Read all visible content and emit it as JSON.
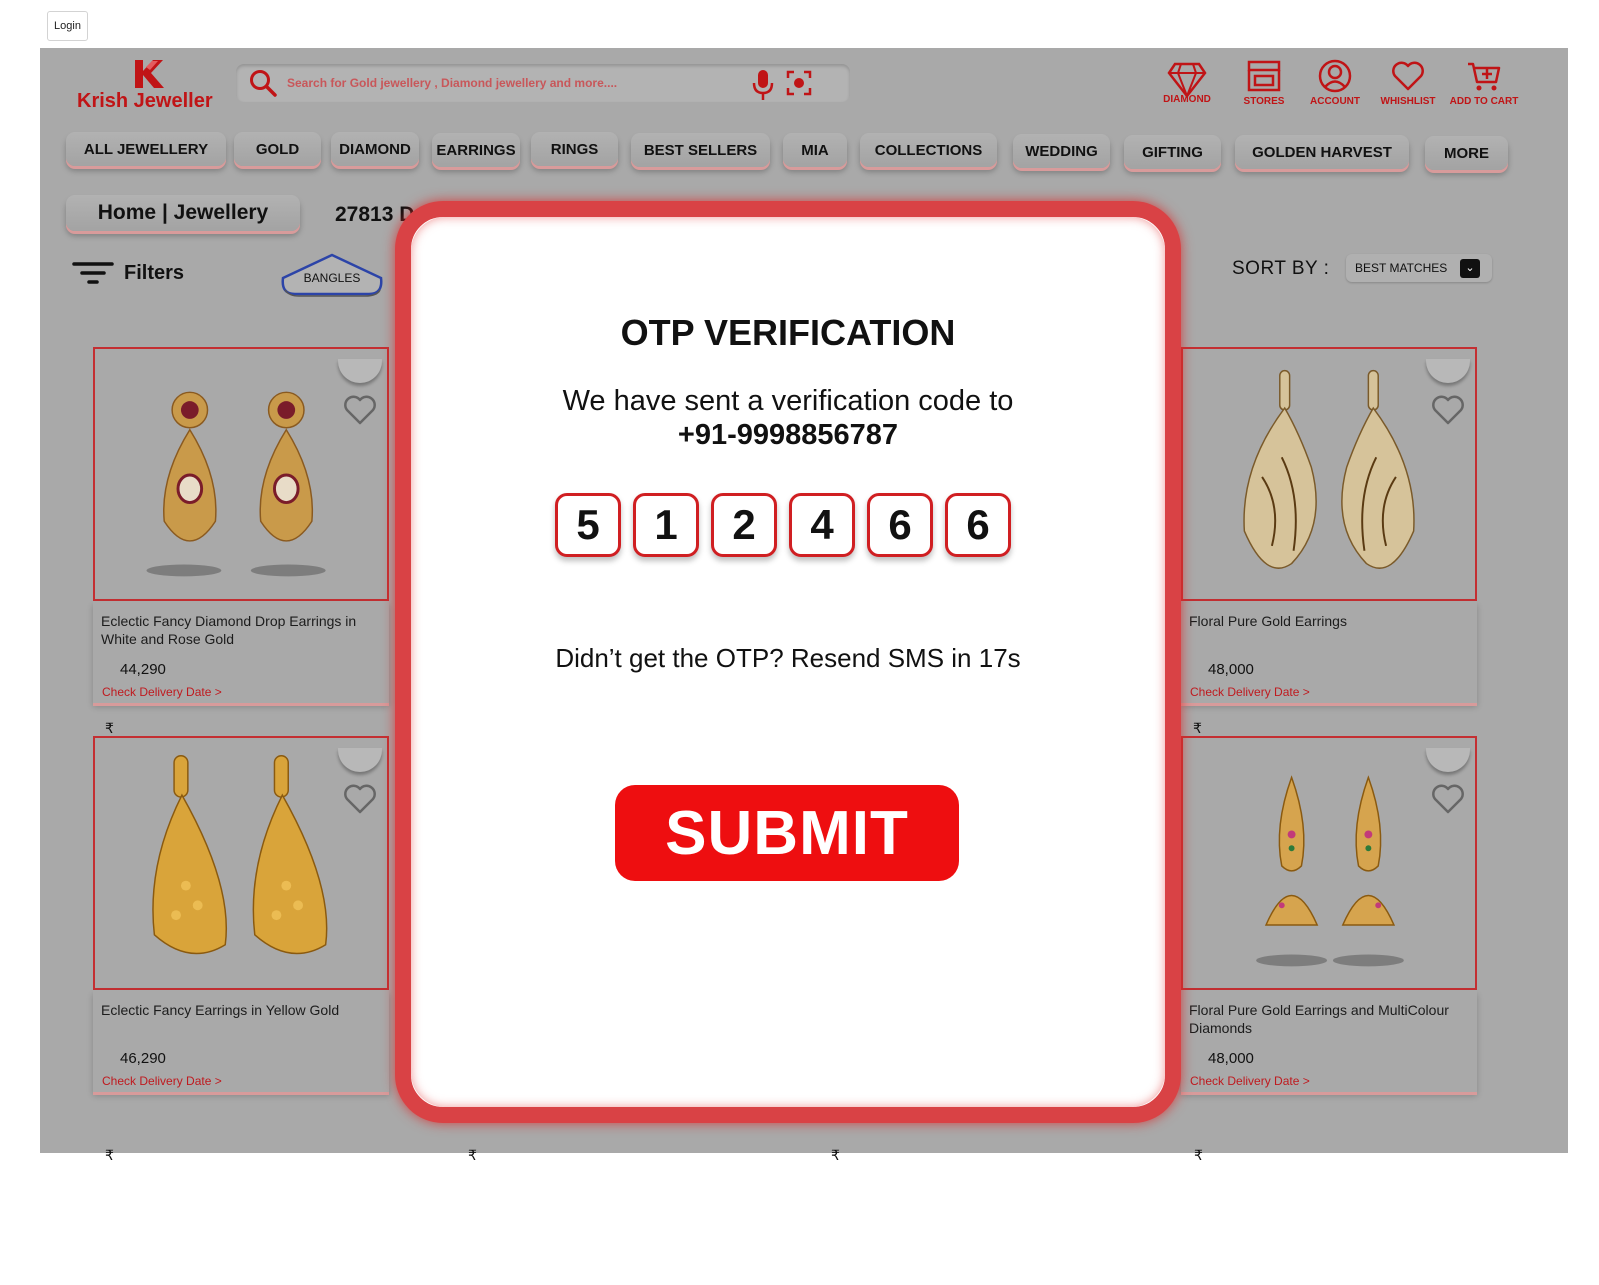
{
  "page": {
    "login_label": "Login"
  },
  "header": {
    "brand": "Krish Jeweller",
    "search_placeholder": "Search  for Gold jewellery , Diamond  jewellery and more....",
    "icons": [
      {
        "label": "DIAMOND",
        "icon": "diamond-icon"
      },
      {
        "label": "STORES",
        "icon": "store-icon"
      },
      {
        "label": "ACCOUNT",
        "icon": "account-icon"
      },
      {
        "label": "WHISHLIST",
        "icon": "heart-icon"
      },
      {
        "label": "ADD TO CART",
        "icon": "cart-icon"
      }
    ],
    "accent": "#c01416"
  },
  "nav": [
    "ALL JEWELLERY",
    "GOLD",
    "DIAMOND",
    "EARRINGS",
    "RINGS",
    "BEST SELLERS",
    "MIA",
    "COLLECTIONS",
    "WEDDING",
    "GIFTING",
    "GOLDEN HARVEST",
    "MORE"
  ],
  "breadcrumb": "Home | Jewellery",
  "result_count": "27813 D",
  "filters": {
    "label": "Filters",
    "chip": "BANGLES"
  },
  "sort": {
    "label": "SORT BY :",
    "value": "BEST MATCHES"
  },
  "products": [
    {
      "name": "Eclectic Fancy Diamond Drop Earrings in White and Rose Gold",
      "price": "44,290",
      "delivery": "Check Delivery Date >"
    },
    {
      "name": "Floral Pure Gold Earrings",
      "price": "48,000",
      "delivery": "Check Delivery Date >"
    },
    {
      "name": "Eclectic Fancy Earrings in Yellow Gold",
      "price": "46,290",
      "delivery": "Check Delivery Date >"
    },
    {
      "name": "Floral Pure Gold Earrings and MultiColour Diamonds",
      "price": "48,000",
      "delivery": "Check Delivery Date >"
    }
  ],
  "currency_symbol": "₹",
  "modal": {
    "title": "OTP VERIFICATION",
    "sent_text": "We have sent a verification code to",
    "phone": "+91-9998856787",
    "otp_digits": [
      "5",
      "1",
      "2",
      "4",
      "6",
      "6"
    ],
    "resend_text": "Didn’t get the OTP? Resend SMS in 17s",
    "submit_label": "SUBMIT",
    "accent": "#ee0e10"
  }
}
